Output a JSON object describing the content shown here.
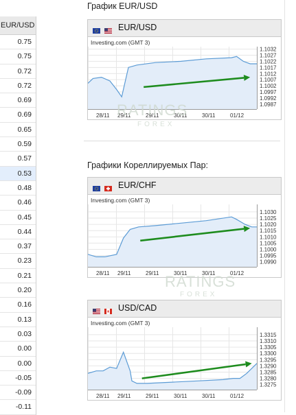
{
  "left_table": {
    "header": "EUR/USD",
    "values": [
      "0.75",
      "0.75",
      "0.72",
      "0.72",
      "0.69",
      "0.69",
      "0.65",
      "0.59",
      "0.57",
      "0.53",
      "0.48",
      "0.46",
      "0.45",
      "0.44",
      "0.37",
      "0.23",
      "0.21",
      "0.20",
      "0.16",
      "0.13",
      "0.03",
      "0.00",
      "0.00",
      "-0.05",
      "-0.09",
      "-0.11"
    ],
    "highlight_index": 9
  },
  "section1_title": "График EUR/USD",
  "section2_title": "Графики Кореллируемых Пар:",
  "watermark": {
    "line1": "RATINGS",
    "line2": "FOREX"
  },
  "chart_data": [
    {
      "type": "area",
      "pair": "EUR/USD",
      "provider": "Investing.com (GMT 3)",
      "flags": [
        "EU",
        "US"
      ],
      "x_ticks": [
        "28/11",
        "29/11",
        "29/11",
        "30/11",
        "30/11",
        "01/12"
      ],
      "y_ticks": [
        1.1032,
        1.1027,
        1.1022,
        1.1017,
        1.1012,
        1.1007,
        1.1002,
        1.0997,
        1.0992,
        1.0987
      ],
      "y_tick_labels": [
        "1.1032",
        "1.1027",
        "1.1022",
        "1.1017",
        "1.1012",
        "1.1007",
        "1.1002",
        "1.0997",
        "1.0992",
        "1.0987"
      ],
      "ylim": [
        1.0983,
        1.1034
      ],
      "x": [
        0,
        0.03,
        0.08,
        0.13,
        0.17,
        0.2,
        0.24,
        0.29,
        0.4,
        0.55,
        0.7,
        0.85,
        0.88,
        0.92,
        0.96,
        1.0
      ],
      "values": [
        1.1004,
        1.1008,
        1.1009,
        1.1006,
        1.0999,
        1.0993,
        1.1017,
        1.1019,
        1.1021,
        1.1022,
        1.1024,
        1.1025,
        1.1026,
        1.1022,
        1.102,
        1.102
      ],
      "trend_arrow": {
        "from": [
          0.33,
          1.1001
        ],
        "to": [
          0.96,
          1.1009
        ]
      },
      "colors": {
        "line": "#5b9bd5",
        "fill": "#e3edf9",
        "arrow": "#1e8c1e"
      }
    },
    {
      "type": "area",
      "pair": "EUR/CHF",
      "provider": "Investing.com (GMT 3)",
      "flags": [
        "EU",
        "CH"
      ],
      "x_ticks": [
        "28/11",
        "29/11",
        "29/11",
        "30/11",
        "30/11",
        "01/12"
      ],
      "y_ticks": [
        1.103,
        1.1025,
        1.102,
        1.1015,
        1.101,
        1.1005,
        1.1,
        1.0995,
        1.099
      ],
      "y_tick_labels": [
        "1.1030",
        "1.1025",
        "1.1020",
        "1.1015",
        "1.1010",
        "1.1005",
        "1.1000",
        "1.0995",
        "1.0990"
      ],
      "ylim": [
        1.0986,
        1.1036
      ],
      "x": [
        0,
        0.05,
        0.1,
        0.17,
        0.21,
        0.25,
        0.3,
        0.4,
        0.55,
        0.7,
        0.85,
        0.88,
        0.93,
        0.97,
        1.0
      ],
      "values": [
        1.0996,
        1.0994,
        1.0994,
        1.0996,
        1.1009,
        1.1016,
        1.1018,
        1.1019,
        1.1021,
        1.1023,
        1.1026,
        1.1024,
        1.102,
        1.1018,
        1.1018
      ],
      "trend_arrow": {
        "from": [
          0.31,
          1.1007
        ],
        "to": [
          0.96,
          1.1017
        ]
      },
      "colors": {
        "line": "#5b9bd5",
        "fill": "#e3edf9",
        "arrow": "#1e8c1e"
      }
    },
    {
      "type": "area",
      "pair": "USD/CAD",
      "provider": "Investing.com (GMT 3)",
      "flags": [
        "US",
        "CA"
      ],
      "x_ticks": [
        "28/11",
        "29/11",
        "29/11",
        "30/11",
        "30/11",
        "01/12"
      ],
      "y_ticks": [
        1.3315,
        1.331,
        1.3305,
        1.33,
        1.3295,
        1.329,
        1.3285,
        1.328,
        1.3275
      ],
      "y_tick_labels": [
        "1.3315",
        "1.3310",
        "1.3305",
        "1.3300",
        "1.3295",
        "1.3290",
        "1.3285",
        "1.3280",
        "1.3275"
      ],
      "ylim": [
        1.3271,
        1.3321
      ],
      "x": [
        0,
        0.05,
        0.09,
        0.13,
        0.17,
        0.21,
        0.25,
        0.26,
        0.29,
        0.35,
        0.5,
        0.65,
        0.8,
        0.86,
        0.9,
        0.94,
        0.97,
        1.0
      ],
      "values": [
        1.3284,
        1.3286,
        1.3286,
        1.3289,
        1.3288,
        1.3301,
        1.3286,
        1.3278,
        1.3276,
        1.3276,
        1.3277,
        1.3278,
        1.3279,
        1.328,
        1.328,
        1.3284,
        1.3288,
        1.3292
      ],
      "trend_arrow": {
        "from": [
          0.32,
          1.328
        ],
        "to": [
          0.97,
          1.3292
        ]
      },
      "colors": {
        "line": "#5b9bd5",
        "fill": "#e3edf9",
        "arrow": "#1e8c1e"
      }
    }
  ]
}
